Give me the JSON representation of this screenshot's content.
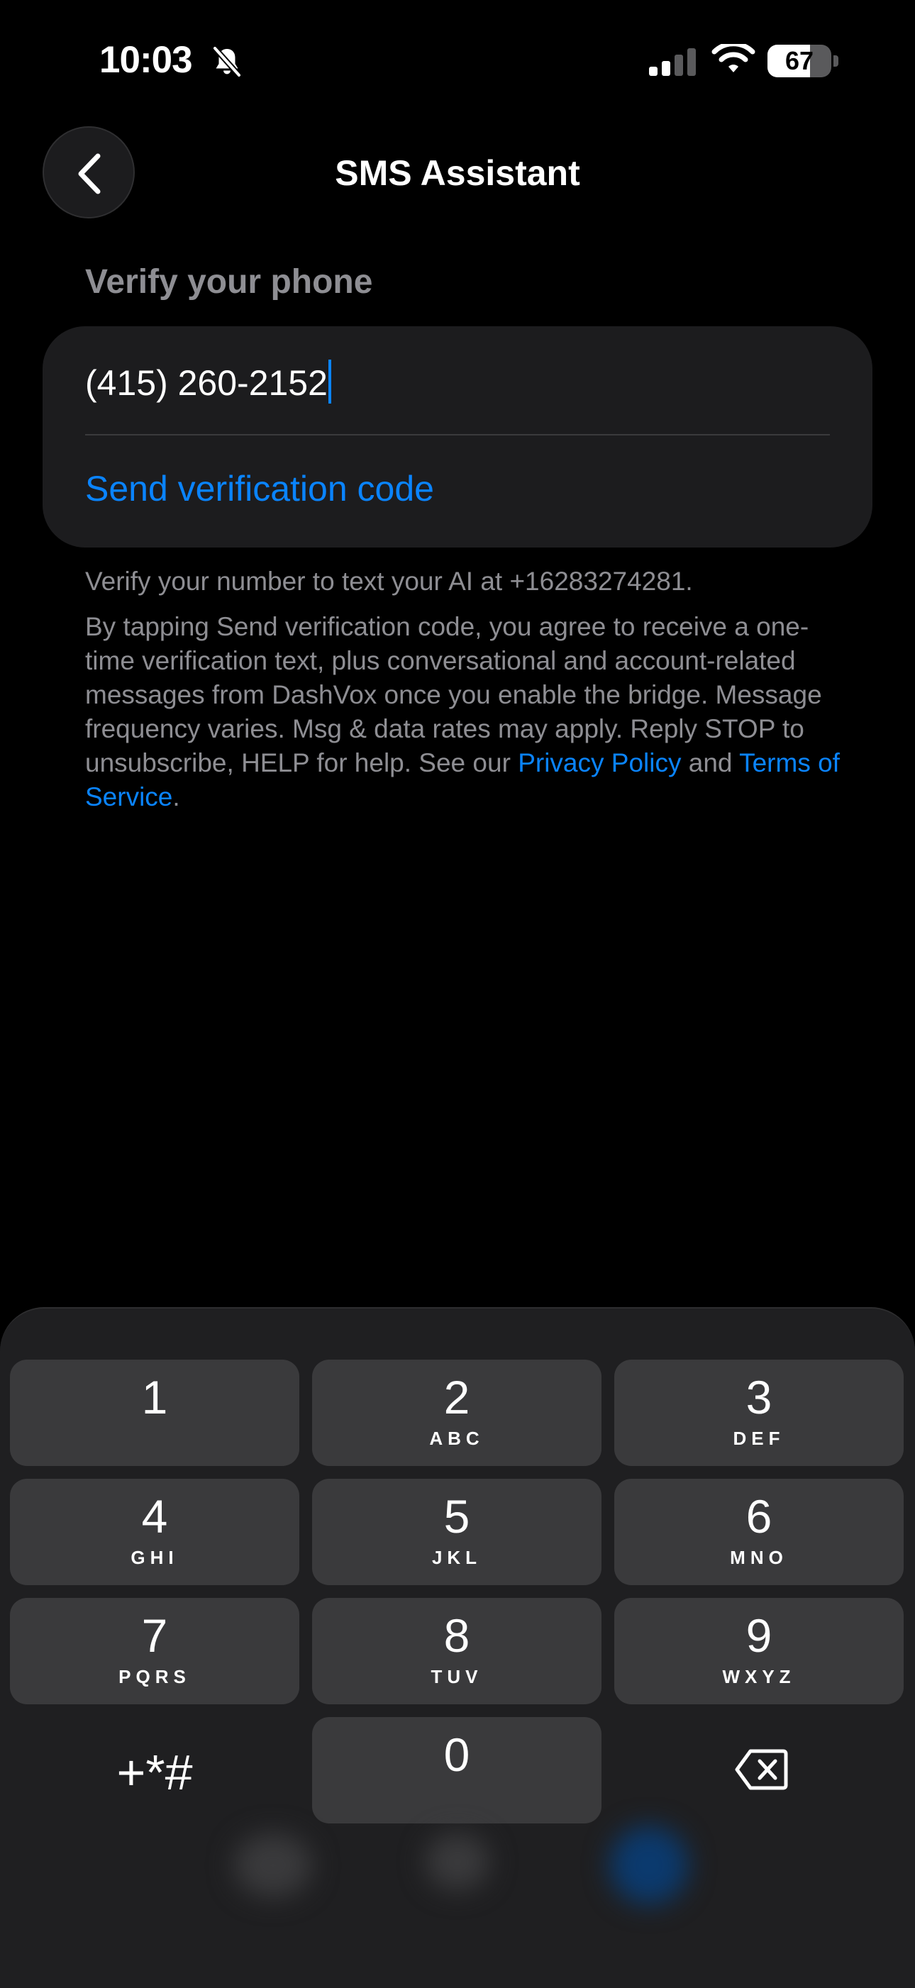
{
  "status_bar": {
    "time": "10:03",
    "battery_level": "67",
    "battery_fraction": 0.67
  },
  "icons": {
    "silent": "bell-slash-icon",
    "signal": "cellular-signal-icon",
    "wifi": "wifi-icon",
    "back": "chevron-left-icon",
    "backspace": "delete-left-icon"
  },
  "nav": {
    "title": "SMS Assistant"
  },
  "form": {
    "section_header": "Verify your phone",
    "phone_value": "(415) 260-2152",
    "send_code_label": "Send verification code"
  },
  "helper": {
    "line1": "Verify your number to text your AI at +16283274281.",
    "consent_text": "By tapping Send verification code, you agree to receive a one-time verification text, plus conversational and account-related messages from DashVox once you enable the bridge. Message frequency varies. Msg & data rates may apply. Reply STOP to unsubscribe, HELP for help. See our ",
    "privacy_link": "Privacy Policy",
    "and_text": " and ",
    "terms_link": "Terms of Service",
    "end_text": "."
  },
  "keypad": {
    "keys": [
      {
        "digit": "1",
        "letters": ""
      },
      {
        "digit": "2",
        "letters": "ABC"
      },
      {
        "digit": "3",
        "letters": "DEF"
      },
      {
        "digit": "4",
        "letters": "GHI"
      },
      {
        "digit": "5",
        "letters": "JKL"
      },
      {
        "digit": "6",
        "letters": "MNO"
      },
      {
        "digit": "7",
        "letters": "PQRS"
      },
      {
        "digit": "8",
        "letters": "TUV"
      },
      {
        "digit": "9",
        "letters": "WXYZ"
      },
      {
        "digit": "0",
        "letters": ""
      }
    ],
    "symbols_label": "+*#"
  },
  "colors": {
    "accent": "#0a84ff",
    "background": "#000000",
    "card": "#1c1c1e",
    "secondary_text": "#8e8e93",
    "key": "#3a3a3c"
  }
}
